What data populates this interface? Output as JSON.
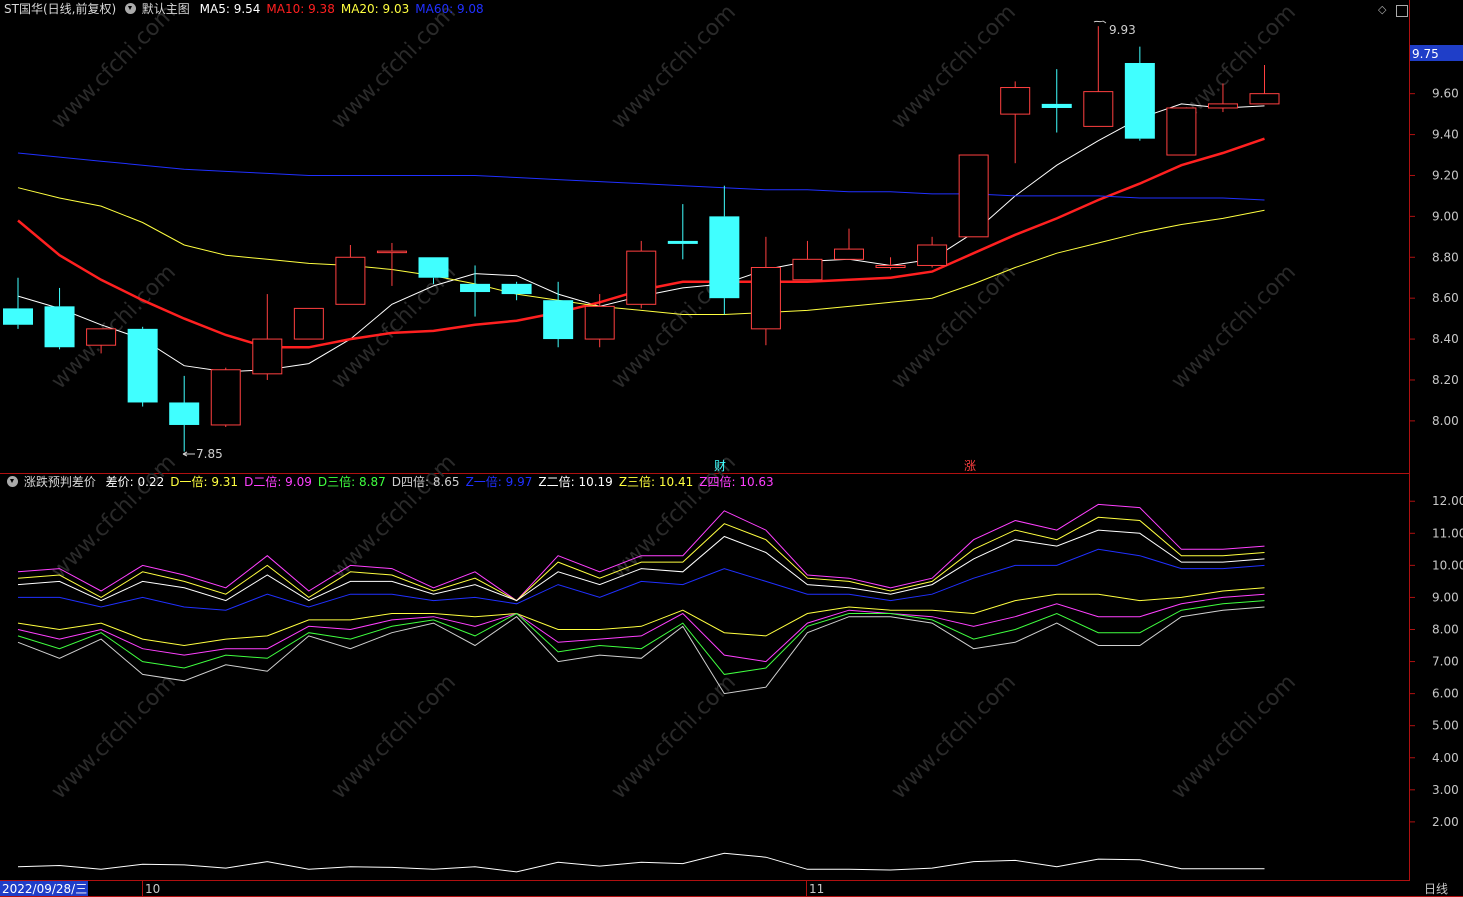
{
  "main": {
    "title": "ST国华(日线,前复权)",
    "template": "默认主图",
    "ma": [
      {
        "label": "MA5:",
        "value": "9.54",
        "color": "#ffffff"
      },
      {
        "label": "MA10:",
        "value": "9.38",
        "color": "#ff2020"
      },
      {
        "label": "MA20:",
        "value": "9.03",
        "color": "#ffff40"
      },
      {
        "label": "MA60:",
        "value": "9.08",
        "color": "#2030ff"
      }
    ],
    "high_mark": "9.93",
    "low_mark": "7.85",
    "price_tag": "9.75",
    "event_1": "财",
    "event_2": "涨"
  },
  "indicator": {
    "name": "涨跌预判差价",
    "items": [
      {
        "label": "差价:",
        "value": "0.22",
        "color": "#ffffff"
      },
      {
        "label": "D一倍:",
        "value": "9.31",
        "color": "#ffff40"
      },
      {
        "label": "D二倍:",
        "value": "9.09",
        "color": "#ff40ff"
      },
      {
        "label": "D三倍:",
        "value": "8.87",
        "color": "#40ff40"
      },
      {
        "label": "D四倍:",
        "value": "8.65",
        "color": "#d0d0d0"
      },
      {
        "label": "Z一倍:",
        "value": "9.97",
        "color": "#2030ff"
      },
      {
        "label": "Z二倍:",
        "value": "10.19",
        "color": "#ffffff"
      },
      {
        "label": "Z三倍:",
        "value": "10.41",
        "color": "#ffff40"
      },
      {
        "label": "Z四倍:",
        "value": "10.63",
        "color": "#ff40ff"
      }
    ]
  },
  "footer": {
    "date": "2022/09/28/三",
    "month_1": "10",
    "month_2": "11",
    "period": "日线"
  },
  "chart_data": [
    {
      "type": "candlestick",
      "y_ticks": [
        "8.00",
        "8.20",
        "8.40",
        "8.60",
        "8.80",
        "9.00",
        "9.20",
        "9.40",
        "9.60"
      ],
      "ylim": [
        7.75,
        9.97
      ],
      "candles": [
        {
          "o": 8.55,
          "h": 8.7,
          "l": 8.45,
          "c": 8.47
        },
        {
          "o": 8.56,
          "h": 8.65,
          "l": 8.35,
          "c": 8.36
        },
        {
          "o": 8.37,
          "h": 8.44,
          "l": 8.33,
          "c": 8.45
        },
        {
          "o": 8.45,
          "h": 8.46,
          "l": 8.07,
          "c": 8.09
        },
        {
          "o": 8.09,
          "h": 8.22,
          "l": 7.85,
          "c": 7.98
        },
        {
          "o": 7.98,
          "h": 8.26,
          "l": 7.97,
          "c": 8.25
        },
        {
          "o": 8.23,
          "h": 8.62,
          "l": 8.2,
          "c": 8.4
        },
        {
          "o": 8.4,
          "h": 8.55,
          "l": 8.4,
          "c": 8.55
        },
        {
          "o": 8.57,
          "h": 8.86,
          "l": 8.57,
          "c": 8.8
        },
        {
          "o": 8.83,
          "h": 8.87,
          "l": 8.66,
          "c": 8.83
        },
        {
          "o": 8.8,
          "h": 8.8,
          "l": 8.67,
          "c": 8.7
        },
        {
          "o": 8.67,
          "h": 8.76,
          "l": 8.51,
          "c": 8.63
        },
        {
          "o": 8.67,
          "h": 8.68,
          "l": 8.59,
          "c": 8.62
        },
        {
          "o": 8.59,
          "h": 8.68,
          "l": 8.36,
          "c": 8.4
        },
        {
          "o": 8.4,
          "h": 8.62,
          "l": 8.36,
          "c": 8.56
        },
        {
          "o": 8.57,
          "h": 8.88,
          "l": 8.55,
          "c": 8.83
        },
        {
          "o": 8.88,
          "h": 9.06,
          "l": 8.79,
          "c": 8.87
        },
        {
          "o": 9.0,
          "h": 9.15,
          "l": 8.52,
          "c": 8.6
        },
        {
          "o": 8.45,
          "h": 8.9,
          "l": 8.37,
          "c": 8.75
        },
        {
          "o": 8.69,
          "h": 8.88,
          "l": 8.69,
          "c": 8.79
        },
        {
          "o": 8.79,
          "h": 8.94,
          "l": 8.79,
          "c": 8.84
        },
        {
          "o": 8.75,
          "h": 8.8,
          "l": 8.74,
          "c": 8.76
        },
        {
          "o": 8.76,
          "h": 8.9,
          "l": 8.75,
          "c": 8.86
        },
        {
          "o": 8.9,
          "h": 9.3,
          "l": 8.9,
          "c": 9.3
        },
        {
          "o": 9.5,
          "h": 9.66,
          "l": 9.26,
          "c": 9.63
        },
        {
          "o": 9.55,
          "h": 9.72,
          "l": 9.41,
          "c": 9.53
        },
        {
          "o": 9.44,
          "h": 9.93,
          "l": 9.44,
          "c": 9.61
        },
        {
          "o": 9.75,
          "h": 9.83,
          "l": 9.37,
          "c": 9.38
        },
        {
          "o": 9.3,
          "h": 9.53,
          "l": 9.3,
          "c": 9.53
        },
        {
          "o": 9.53,
          "h": 9.65,
          "l": 9.51,
          "c": 9.55
        },
        {
          "o": 9.55,
          "h": 9.74,
          "l": 9.55,
          "c": 9.6
        }
      ],
      "series": [
        {
          "name": "MA5",
          "color": "#ffffff",
          "width": 1,
          "values": [
            8.61,
            8.55,
            8.47,
            8.4,
            8.27,
            8.24,
            8.25,
            8.28,
            8.4,
            8.57,
            8.66,
            8.72,
            8.71,
            8.62,
            8.56,
            8.61,
            8.65,
            8.67,
            8.74,
            8.78,
            8.79,
            8.76,
            8.79,
            8.92,
            9.1,
            9.25,
            9.37,
            9.48,
            9.55,
            9.53,
            9.54
          ]
        },
        {
          "name": "MA10",
          "color": "#ff2020",
          "width": 2.5,
          "values": [
            8.98,
            8.81,
            8.69,
            8.59,
            8.5,
            8.42,
            8.36,
            8.36,
            8.4,
            8.43,
            8.44,
            8.47,
            8.49,
            8.53,
            8.58,
            8.64,
            8.68,
            8.68,
            8.68,
            8.68,
            8.69,
            8.7,
            8.73,
            8.82,
            8.91,
            8.99,
            9.08,
            9.16,
            9.25,
            9.31,
            9.38
          ]
        },
        {
          "name": "MA20",
          "color": "#ffff40",
          "width": 1,
          "values": [
            9.14,
            9.09,
            9.05,
            8.97,
            8.86,
            8.81,
            8.79,
            8.77,
            8.76,
            8.74,
            8.71,
            8.67,
            8.62,
            8.59,
            8.56,
            8.54,
            8.52,
            8.52,
            8.53,
            8.54,
            8.56,
            8.58,
            8.6,
            8.67,
            8.75,
            8.82,
            8.87,
            8.92,
            8.96,
            8.99,
            9.03
          ]
        },
        {
          "name": "MA60",
          "color": "#2030ff",
          "width": 1,
          "values": [
            9.31,
            9.29,
            9.27,
            9.25,
            9.23,
            9.22,
            9.21,
            9.2,
            9.2,
            9.2,
            9.2,
            9.2,
            9.19,
            9.18,
            9.17,
            9.16,
            9.15,
            9.14,
            9.13,
            9.13,
            9.12,
            9.12,
            9.11,
            9.11,
            9.1,
            9.1,
            9.1,
            9.09,
            9.09,
            9.09,
            9.08
          ]
        }
      ]
    },
    {
      "type": "line",
      "y_ticks": [
        "2.00",
        "3.00",
        "4.00",
        "5.00",
        "6.00",
        "7.00",
        "8.00",
        "9.00",
        "10.00",
        "11.00",
        "12.00"
      ],
      "ylim": [
        0.25,
        12.35
      ],
      "series": [
        {
          "name": "Z四倍",
          "color": "#ff40ff",
          "values": [
            9.8,
            9.9,
            9.2,
            10.0,
            9.7,
            9.3,
            10.3,
            9.2,
            10.0,
            9.9,
            9.3,
            9.8,
            8.9,
            10.3,
            9.8,
            10.3,
            10.3,
            11.7,
            11.1,
            9.7,
            9.6,
            9.3,
            9.6,
            10.8,
            11.4,
            11.1,
            11.9,
            11.8,
            10.5,
            10.5,
            10.6
          ]
        },
        {
          "name": "Z三倍",
          "color": "#ffff40",
          "values": [
            9.6,
            9.7,
            9.0,
            9.8,
            9.5,
            9.1,
            10.0,
            9.0,
            9.8,
            9.7,
            9.2,
            9.6,
            8.9,
            10.1,
            9.6,
            10.1,
            10.1,
            11.3,
            10.8,
            9.6,
            9.5,
            9.2,
            9.5,
            10.5,
            11.1,
            10.8,
            11.5,
            11.4,
            10.3,
            10.3,
            10.4
          ]
        },
        {
          "name": "Z二倍",
          "color": "#ffffff",
          "values": [
            9.4,
            9.5,
            8.9,
            9.5,
            9.3,
            8.9,
            9.7,
            8.9,
            9.5,
            9.5,
            9.1,
            9.4,
            8.9,
            9.8,
            9.4,
            9.9,
            9.8,
            10.9,
            10.4,
            9.4,
            9.3,
            9.1,
            9.4,
            10.2,
            10.8,
            10.6,
            11.1,
            11.0,
            10.1,
            10.1,
            10.2
          ]
        },
        {
          "name": "Z一倍",
          "color": "#2030ff",
          "values": [
            9.0,
            9.0,
            8.7,
            9.0,
            8.7,
            8.6,
            9.1,
            8.7,
            9.1,
            9.1,
            8.9,
            9.0,
            8.8,
            9.4,
            9.0,
            9.5,
            9.4,
            9.9,
            9.5,
            9.1,
            9.1,
            8.9,
            9.1,
            9.6,
            10.0,
            10.0,
            10.5,
            10.3,
            9.9,
            9.9,
            10.0
          ]
        },
        {
          "name": "D一倍",
          "color": "#ffff40",
          "values": [
            8.2,
            8.0,
            8.2,
            7.7,
            7.5,
            7.7,
            7.8,
            8.3,
            8.3,
            8.5,
            8.5,
            8.4,
            8.5,
            8.0,
            8.0,
            8.1,
            8.6,
            7.9,
            7.8,
            8.5,
            8.7,
            8.6,
            8.6,
            8.5,
            8.9,
            9.1,
            9.1,
            8.9,
            9.0,
            9.2,
            9.3
          ]
        },
        {
          "name": "D二倍",
          "color": "#ff40ff",
          "values": [
            8.0,
            7.7,
            8.0,
            7.4,
            7.2,
            7.4,
            7.4,
            8.1,
            8.0,
            8.3,
            8.4,
            8.1,
            8.5,
            7.6,
            7.7,
            7.8,
            8.5,
            7.2,
            7.0,
            8.2,
            8.6,
            8.5,
            8.4,
            8.1,
            8.4,
            8.8,
            8.4,
            8.4,
            8.8,
            9.0,
            9.1
          ]
        },
        {
          "name": "D三倍",
          "color": "#40ff40",
          "values": [
            7.8,
            7.4,
            7.9,
            7.0,
            6.8,
            7.2,
            7.1,
            7.9,
            7.7,
            8.1,
            8.3,
            7.8,
            8.5,
            7.3,
            7.5,
            7.4,
            8.2,
            6.6,
            6.8,
            8.1,
            8.5,
            8.5,
            8.3,
            7.7,
            8.0,
            8.5,
            7.9,
            7.9,
            8.6,
            8.8,
            8.9
          ]
        },
        {
          "name": "D四倍",
          "color": "#d0d0d0",
          "values": [
            7.6,
            7.1,
            7.7,
            6.6,
            6.4,
            6.9,
            6.7,
            7.8,
            7.4,
            7.9,
            8.2,
            7.5,
            8.4,
            7.0,
            7.2,
            7.1,
            8.1,
            6.0,
            6.2,
            7.9,
            8.4,
            8.4,
            8.2,
            7.4,
            7.6,
            8.2,
            7.5,
            7.5,
            8.4,
            8.6,
            8.7
          ]
        },
        {
          "name": "差价",
          "color": "#ffffff",
          "values": [
            0.6,
            0.64,
            0.52,
            0.68,
            0.66,
            0.56,
            0.76,
            0.52,
            0.6,
            0.58,
            0.52,
            0.6,
            0.44,
            0.74,
            0.62,
            0.74,
            0.7,
            1.02,
            0.9,
            0.52,
            0.52,
            0.5,
            0.56,
            0.76,
            0.8,
            0.6,
            0.84,
            0.82,
            0.54,
            0.54,
            0.54
          ]
        }
      ]
    }
  ]
}
